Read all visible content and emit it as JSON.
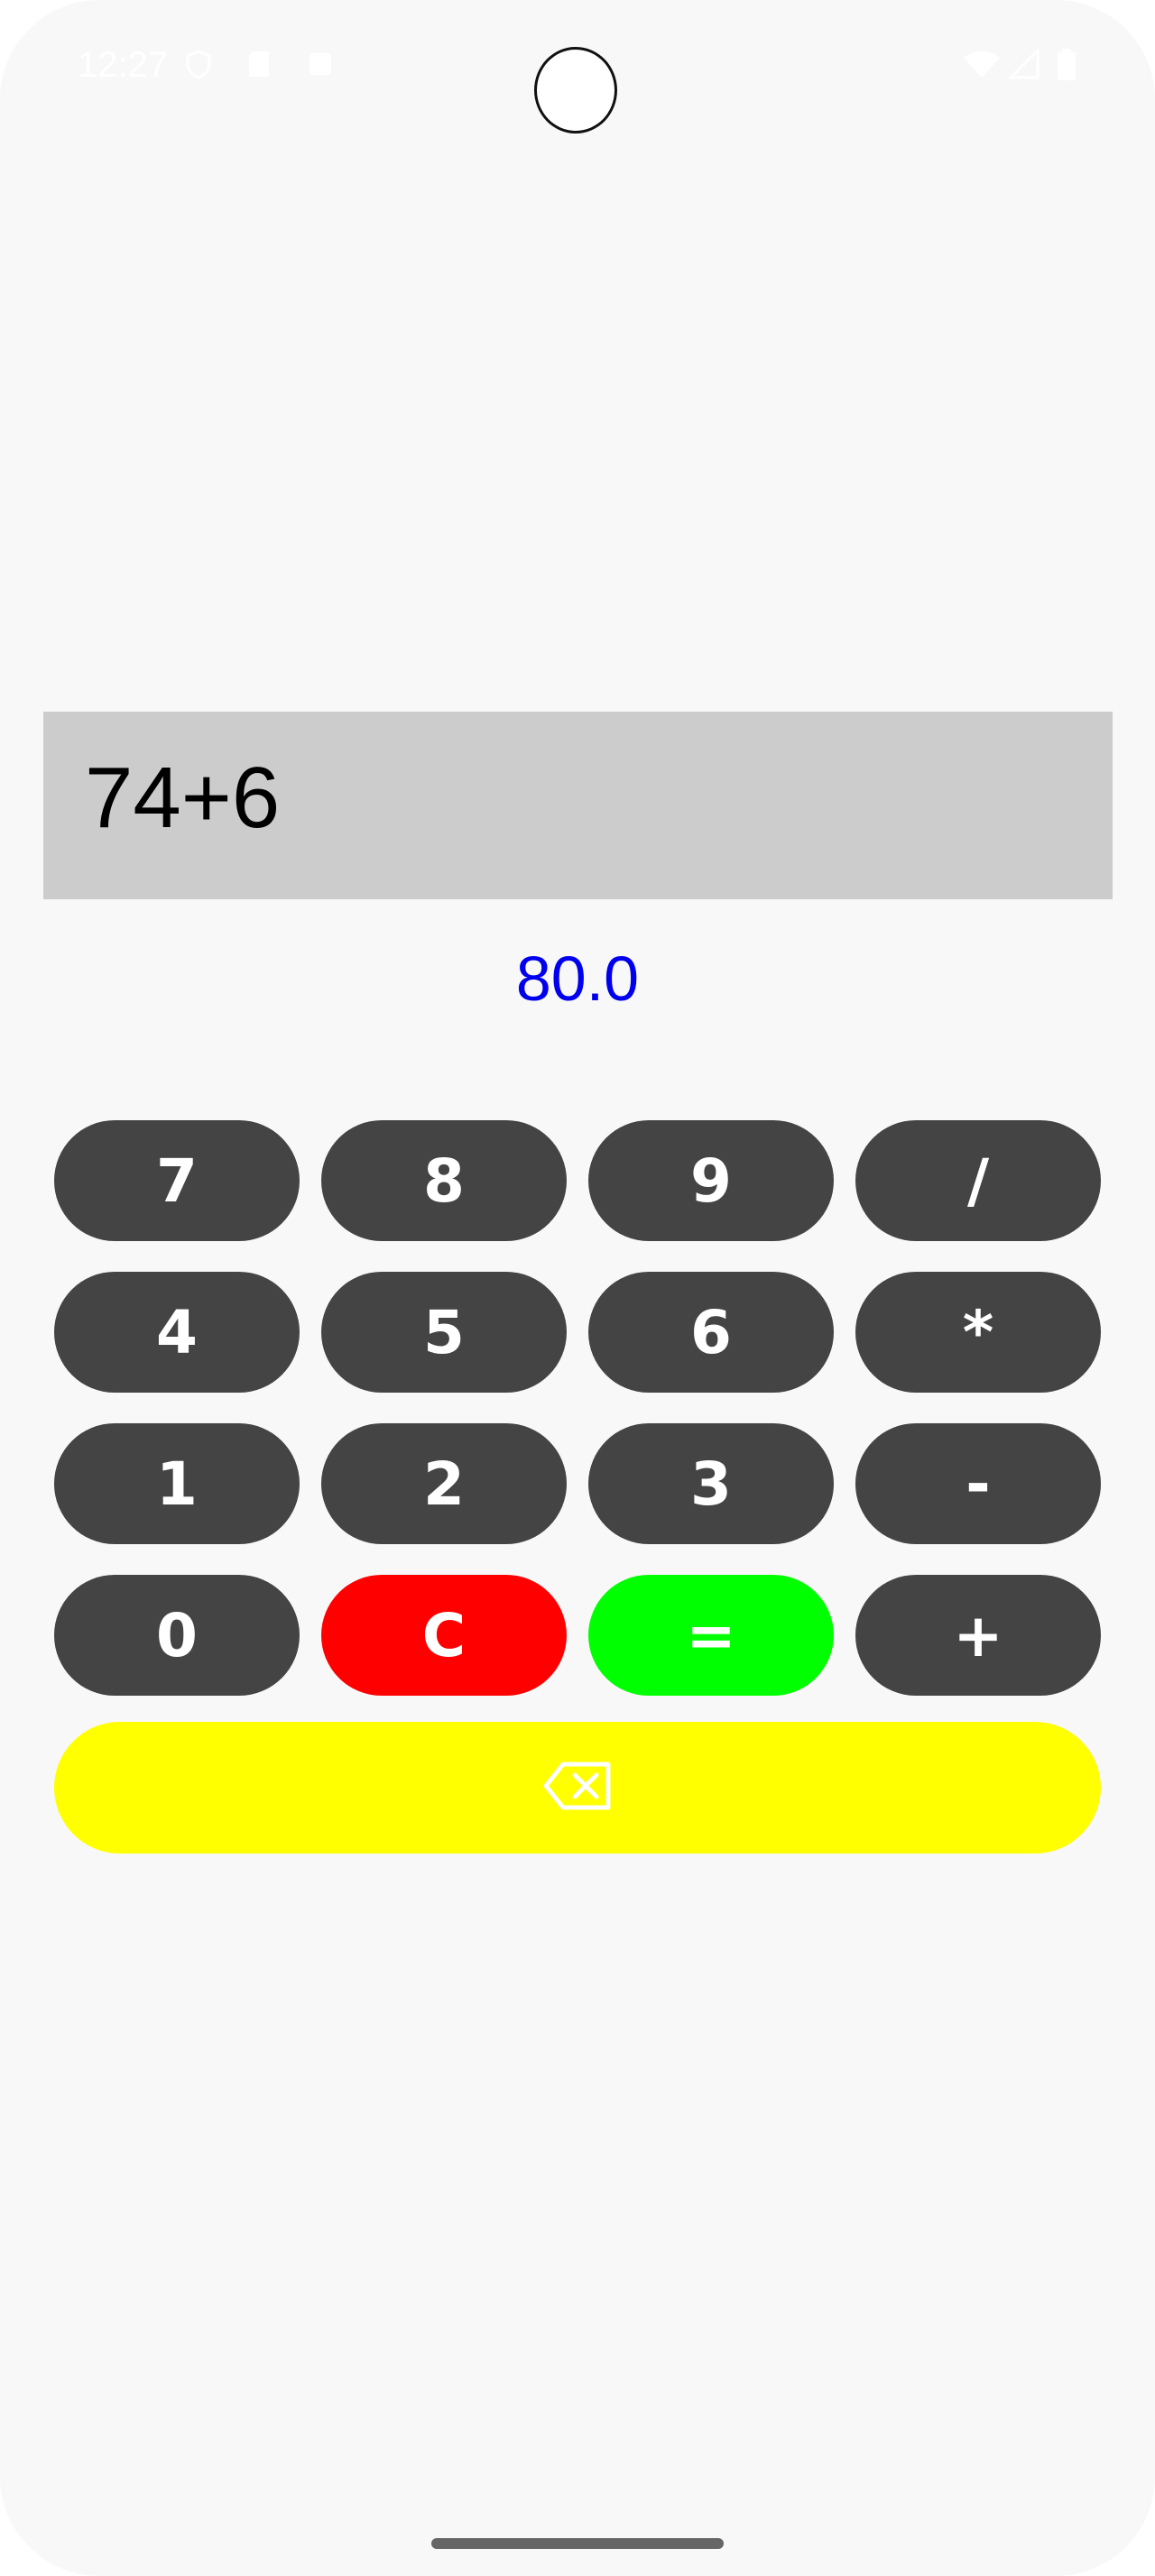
{
  "status_bar": {
    "time": "12:27",
    "icons": [
      "shield-icon",
      "sd-card-icon",
      "notification-icon",
      "wifi-icon",
      "signal-icon",
      "battery-icon"
    ]
  },
  "display": {
    "expression": "74+6",
    "result": "80.0"
  },
  "keypad": {
    "rows": [
      [
        "7",
        "8",
        "9",
        "/"
      ],
      [
        "4",
        "5",
        "6",
        "*"
      ],
      [
        "1",
        "2",
        "3",
        "-"
      ],
      [
        "0",
        "C",
        "=",
        "+"
      ]
    ],
    "backspace_icon": "backspace-icon"
  },
  "colors": {
    "display_bg": "#cccccc",
    "result_text": "#0000ee",
    "key_bg": "#444444",
    "clear_bg": "#ff0000",
    "equals_bg": "#00ff00",
    "backspace_bg": "#ffff00"
  }
}
